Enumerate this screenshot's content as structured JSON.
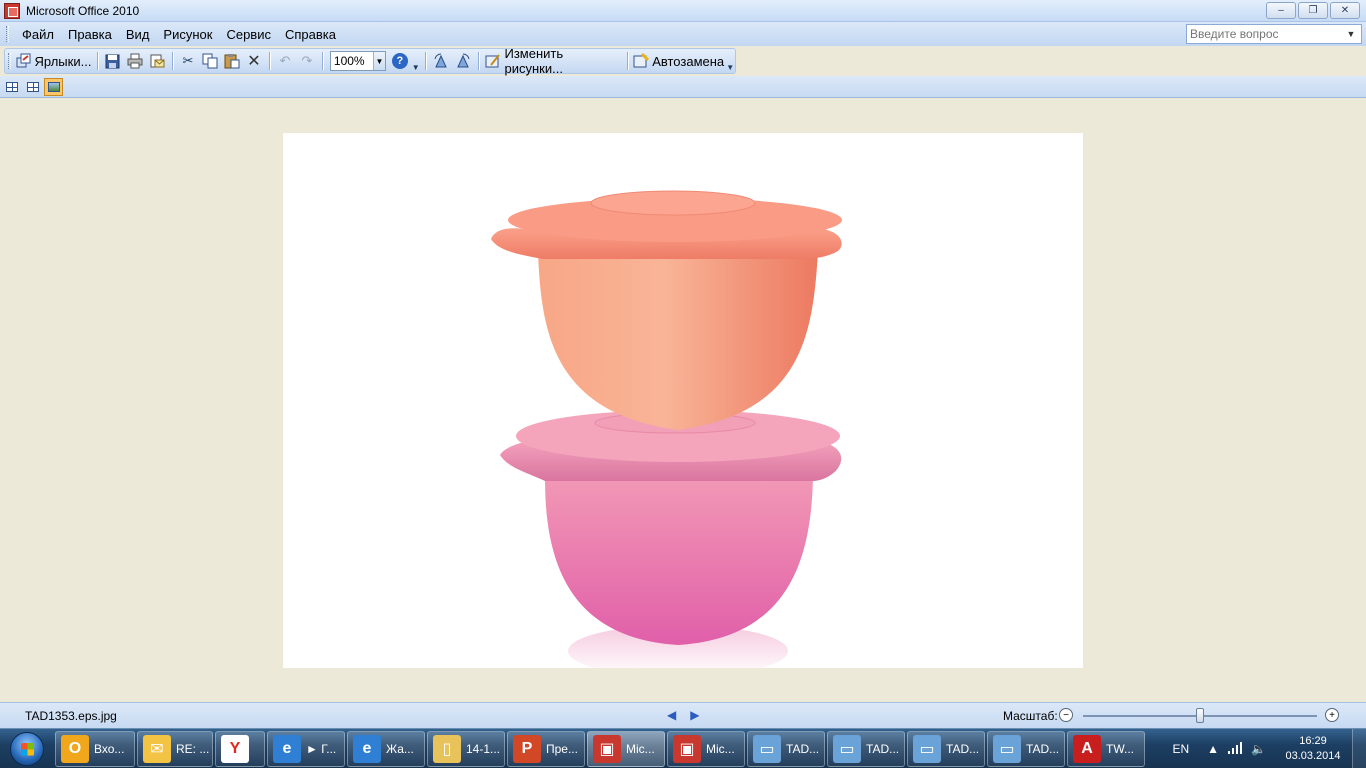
{
  "window": {
    "title": "Microsoft Office 2010",
    "minimize_glyph": "‒",
    "restore_glyph": "❐",
    "close_glyph": "✕"
  },
  "menu": {
    "items": [
      "Файл",
      "Правка",
      "Вид",
      "Рисунок",
      "Сервис",
      "Справка"
    ],
    "help_placeholder": "Введите вопрос"
  },
  "toolbar": {
    "shortcuts_label": "Ярлыки...",
    "zoom_value": "100%",
    "edit_pictures_label": "Изменить рисунки...",
    "autocorrect_label": "Автозамена"
  },
  "status": {
    "file_name": "TAD1353.eps.jpg",
    "zoom_label": "Масштаб:",
    "zoom_slider_fraction": 0.5
  },
  "taskbar": {
    "tasks": [
      {
        "label": "Вхо...",
        "icon": "outlook-icon",
        "color": "#f0a71b"
      },
      {
        "label": "RE: ...",
        "icon": "mail-envelope-icon",
        "color": "#f3c344"
      },
      {
        "label": "",
        "icon": "yandex-browser-icon",
        "color": "#ffffff"
      },
      {
        "label": "► Г...",
        "icon": "internet-explorer-icon",
        "color": "#2f7fd5"
      },
      {
        "label": "Жа...",
        "icon": "internet-explorer-icon",
        "color": "#2f7fd5"
      },
      {
        "label": "14-1...",
        "icon": "folder-icon",
        "color": "#e8c25a"
      },
      {
        "label": "Пре...",
        "icon": "powerpoint-icon",
        "color": "#d24726"
      },
      {
        "label": "Mic...",
        "icon": "picture-manager-icon",
        "color": "#c8382f"
      },
      {
        "label": "Mic...",
        "icon": "picture-manager-icon",
        "color": "#c8382f"
      },
      {
        "label": "TAD...",
        "icon": "image-file-icon",
        "color": "#6aa3d8"
      },
      {
        "label": "TAD...",
        "icon": "image-file-icon",
        "color": "#6aa3d8"
      },
      {
        "label": "TAD...",
        "icon": "image-file-icon",
        "color": "#6aa3d8"
      },
      {
        "label": "TAD...",
        "icon": "image-file-icon",
        "color": "#6aa3d8"
      },
      {
        "label": "TW...",
        "icon": "pdf-icon",
        "color": "#c81e1e"
      }
    ],
    "language": "EN",
    "time": "16:29",
    "date": "03.03.2014"
  }
}
